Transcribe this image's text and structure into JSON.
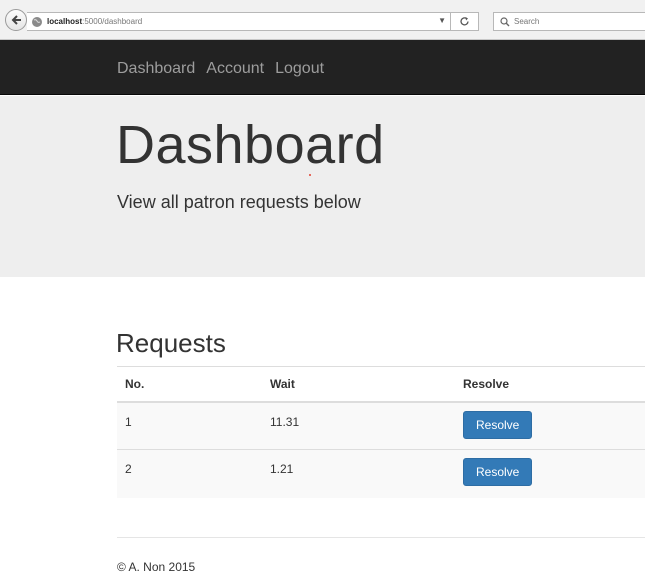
{
  "browser": {
    "url_host": "localhost",
    "url_path": ":5000/dashboard",
    "search_placeholder": "Search"
  },
  "navbar": {
    "items": [
      {
        "label": "Dashboard"
      },
      {
        "label": "Account"
      },
      {
        "label": "Logout"
      }
    ]
  },
  "jumbotron": {
    "title": "Dashboard",
    "subtitle": "View all patron requests below"
  },
  "requests": {
    "title": "Requests",
    "columns": [
      "No.",
      "Wait",
      "Resolve"
    ],
    "rows": [
      {
        "no": "1",
        "wait": "11.31",
        "action": "Resolve"
      },
      {
        "no": "2",
        "wait": "1.21",
        "action": "Resolve"
      }
    ]
  },
  "footer": {
    "text": "© A. Non 2015"
  },
  "colors": {
    "navbar_bg": "#222222",
    "jumbotron_bg": "#eeeeee",
    "primary_button": "#337ab7"
  }
}
